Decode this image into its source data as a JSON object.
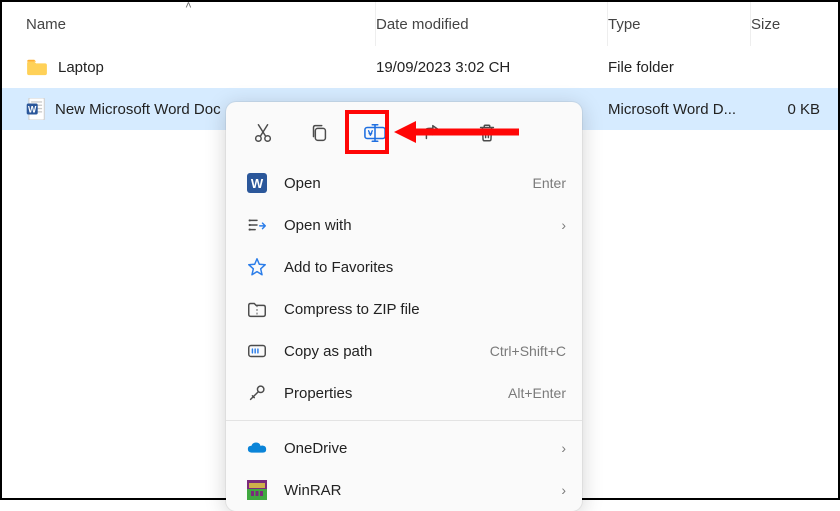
{
  "columns": {
    "name": "Name",
    "date": "Date modified",
    "type": "Type",
    "size": "Size"
  },
  "rows": [
    {
      "name": "Laptop",
      "date": "19/09/2023 3:02 CH",
      "type": "File folder",
      "size": ""
    },
    {
      "name": "New Microsoft Word Doc",
      "date": "",
      "type": "Microsoft Word D...",
      "size": "0 KB"
    }
  ],
  "toolbar": {
    "cut": "cut-icon",
    "copy": "copy-icon",
    "rename": "rename-icon",
    "share": "share-icon",
    "delete": "delete-icon"
  },
  "menu": {
    "open": {
      "label": "Open",
      "shortcut": "Enter"
    },
    "openwith": {
      "label": "Open with"
    },
    "fav": {
      "label": "Add to Favorites"
    },
    "zip": {
      "label": "Compress to ZIP file"
    },
    "copypath": {
      "label": "Copy as path",
      "shortcut": "Ctrl+Shift+C"
    },
    "props": {
      "label": "Properties",
      "shortcut": "Alt+Enter"
    },
    "onedrive": {
      "label": "OneDrive"
    },
    "winrar": {
      "label": "WinRAR"
    }
  }
}
